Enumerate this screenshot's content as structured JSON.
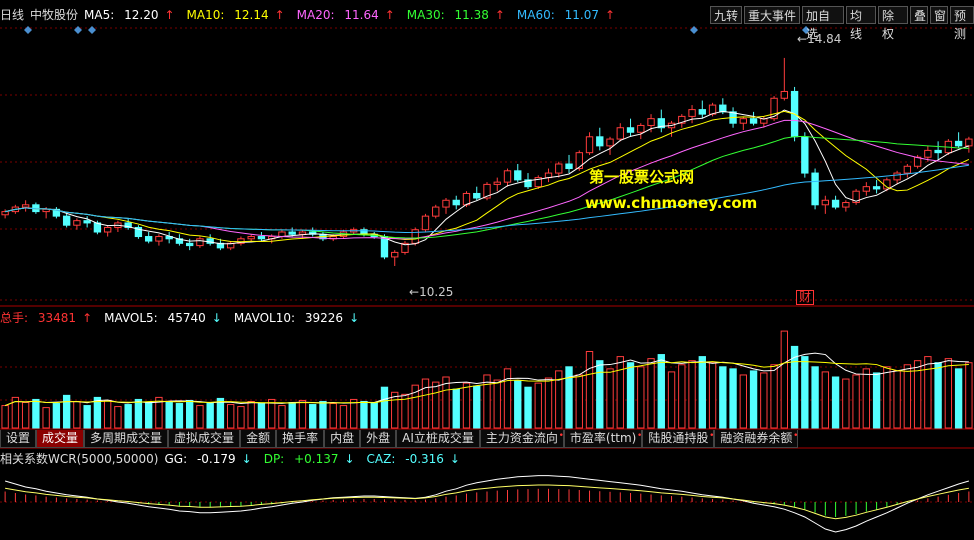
{
  "main_header": {
    "period": "日线",
    "stock_name": "中牧股份",
    "ma5_label": "MA5:",
    "ma5": "12.20",
    "ma5_arrow": "↑",
    "ma10_label": "MA10:",
    "ma10": "12.14",
    "ma10_arrow": "↑",
    "ma20_label": "MA20:",
    "ma20": "11.64",
    "ma20_arrow": "↑",
    "ma30_label": "MA30:",
    "ma30": "11.38",
    "ma30_arrow": "↑",
    "ma60_label": "MA60:",
    "ma60": "11.07",
    "ma60_arrow": "↑"
  },
  "toolbar": [
    "九转",
    "重大事件",
    "加自选",
    "均线",
    "除权",
    "叠",
    "窗",
    "预测"
  ],
  "price_high_label": "14.84",
  "price_low_label": "10.25",
  "fin_marker": "财",
  "watermark": {
    "line1": "第一股票公式网",
    "line2": "www.chnmoney.com"
  },
  "volume_header": {
    "label": "总手:",
    "value": "33481",
    "arrow": "↑",
    "mavol5_label": "MAVOL5:",
    "mavol5": "45740",
    "mavol5_arrow": "↓",
    "mavol10_label": "MAVOL10:",
    "mavol10": "39226",
    "mavol10_arrow": "↓"
  },
  "indicator_tabs": [
    {
      "label": "设置",
      "active": false,
      "dot": false
    },
    {
      "label": "成交量",
      "active": true,
      "dot": false
    },
    {
      "label": "多周期成交量",
      "active": false,
      "dot": false
    },
    {
      "label": "虚拟成交量",
      "active": false,
      "dot": false
    },
    {
      "label": "金额",
      "active": false,
      "dot": false
    },
    {
      "label": "换手率",
      "active": false,
      "dot": false
    },
    {
      "label": "内盘",
      "active": false,
      "dot": false
    },
    {
      "label": "外盘",
      "active": false,
      "dot": false
    },
    {
      "label": "AI立桩成交量",
      "active": false,
      "dot": false
    },
    {
      "label": "主力资金流向",
      "active": false,
      "dot": true
    },
    {
      "label": "市盈率(ttm)",
      "active": false,
      "dot": true
    },
    {
      "label": "陆股通持股",
      "active": false,
      "dot": true
    },
    {
      "label": "融资融券余额",
      "active": false,
      "dot": true
    }
  ],
  "indicator_header": {
    "name": "相关系数WCR(5000,50000)",
    "gg_label": "GG:",
    "gg": "-0.179",
    "gg_arrow": "↓",
    "dp_label": "DP:",
    "dp": "+0.137",
    "dp_arrow": "↓",
    "caz_label": "CAZ:",
    "caz": "-0.316",
    "caz_arrow": "↓"
  },
  "colors": {
    "up": "#ff3c3c",
    "down": "#54ffff",
    "ma5": "#ffffff",
    "ma10": "#ffff00",
    "ma20": "#ff66ff",
    "ma30": "#33ff33",
    "ma60": "#33bbff",
    "grid": "#7a0000"
  },
  "chart_data": {
    "type": "candlestick",
    "y_range": [
      9.5,
      15.5
    ],
    "candles": [
      [
        11.38,
        11.5,
        11.3,
        11.45
      ],
      [
        11.45,
        11.6,
        11.4,
        11.55
      ],
      [
        11.55,
        11.7,
        11.45,
        11.6
      ],
      [
        11.6,
        11.65,
        11.4,
        11.45
      ],
      [
        11.45,
        11.55,
        11.3,
        11.5
      ],
      [
        11.5,
        11.55,
        11.3,
        11.35
      ],
      [
        11.35,
        11.45,
        11.1,
        11.15
      ],
      [
        11.15,
        11.3,
        11.05,
        11.25
      ],
      [
        11.25,
        11.35,
        11.1,
        11.2
      ],
      [
        11.2,
        11.25,
        10.95,
        11.0
      ],
      [
        11.0,
        11.15,
        10.9,
        11.1
      ],
      [
        11.1,
        11.25,
        11.0,
        11.2
      ],
      [
        11.2,
        11.3,
        11.05,
        11.1
      ],
      [
        11.1,
        11.15,
        10.85,
        10.9
      ],
      [
        10.9,
        11.0,
        10.75,
        10.8
      ],
      [
        10.8,
        10.95,
        10.7,
        10.9
      ],
      [
        10.9,
        11.0,
        10.75,
        10.85
      ],
      [
        10.85,
        10.95,
        10.7,
        10.75
      ],
      [
        10.75,
        10.85,
        10.6,
        10.7
      ],
      [
        10.7,
        10.9,
        10.65,
        10.85
      ],
      [
        10.85,
        10.95,
        10.7,
        10.75
      ],
      [
        10.75,
        10.85,
        10.6,
        10.65
      ],
      [
        10.65,
        10.8,
        10.6,
        10.75
      ],
      [
        10.75,
        10.9,
        10.7,
        10.85
      ],
      [
        10.85,
        10.95,
        10.8,
        10.9
      ],
      [
        10.9,
        11.0,
        10.8,
        10.85
      ],
      [
        10.85,
        10.95,
        10.75,
        10.9
      ],
      [
        10.9,
        11.05,
        10.85,
        11.0
      ],
      [
        11.0,
        11.1,
        10.9,
        10.95
      ],
      [
        10.95,
        11.05,
        10.85,
        11.0
      ],
      [
        11.0,
        11.1,
        10.9,
        10.95
      ],
      [
        10.95,
        11.0,
        10.8,
        10.85
      ],
      [
        10.85,
        10.95,
        10.8,
        10.9
      ],
      [
        10.9,
        11.05,
        10.85,
        11.0
      ],
      [
        11.0,
        11.1,
        10.95,
        11.05
      ],
      [
        11.05,
        11.1,
        10.9,
        10.95
      ],
      [
        10.95,
        11.0,
        10.85,
        10.9
      ],
      [
        10.9,
        10.95,
        10.4,
        10.45
      ],
      [
        10.45,
        10.6,
        10.25,
        10.55
      ],
      [
        10.55,
        10.8,
        10.5,
        10.75
      ],
      [
        10.75,
        11.1,
        10.7,
        11.05
      ],
      [
        11.05,
        11.4,
        11.0,
        11.35
      ],
      [
        11.35,
        11.6,
        11.3,
        11.55
      ],
      [
        11.55,
        11.75,
        11.4,
        11.7
      ],
      [
        11.7,
        11.8,
        11.5,
        11.6
      ],
      [
        11.6,
        11.9,
        11.55,
        11.85
      ],
      [
        11.85,
        12.0,
        11.7,
        11.75
      ],
      [
        11.75,
        12.1,
        11.7,
        12.05
      ],
      [
        12.05,
        12.2,
        11.9,
        12.1
      ],
      [
        12.1,
        12.4,
        12.0,
        12.35
      ],
      [
        12.35,
        12.5,
        12.1,
        12.15
      ],
      [
        12.15,
        12.3,
        11.95,
        12.0
      ],
      [
        12.0,
        12.25,
        11.95,
        12.2
      ],
      [
        12.2,
        12.4,
        12.1,
        12.3
      ],
      [
        12.3,
        12.55,
        12.2,
        12.5
      ],
      [
        12.5,
        12.7,
        12.3,
        12.4
      ],
      [
        12.4,
        12.8,
        12.35,
        12.75
      ],
      [
        12.75,
        13.2,
        12.7,
        13.1
      ],
      [
        13.1,
        13.3,
        12.8,
        12.9
      ],
      [
        12.9,
        13.1,
        12.7,
        13.05
      ],
      [
        13.05,
        13.4,
        13.0,
        13.3
      ],
      [
        13.3,
        13.5,
        13.1,
        13.2
      ],
      [
        13.2,
        13.4,
        13.05,
        13.35
      ],
      [
        13.35,
        13.6,
        13.2,
        13.5
      ],
      [
        13.5,
        13.7,
        13.2,
        13.3
      ],
      [
        13.3,
        13.45,
        13.1,
        13.4
      ],
      [
        13.4,
        13.6,
        13.3,
        13.55
      ],
      [
        13.55,
        13.8,
        13.4,
        13.7
      ],
      [
        13.7,
        13.9,
        13.5,
        13.6
      ],
      [
        13.6,
        13.85,
        13.55,
        13.8
      ],
      [
        13.8,
        13.95,
        13.6,
        13.65
      ],
      [
        13.65,
        13.75,
        13.3,
        13.4
      ],
      [
        13.4,
        13.55,
        13.25,
        13.5
      ],
      [
        13.5,
        13.65,
        13.35,
        13.4
      ],
      [
        13.4,
        13.55,
        13.3,
        13.5
      ],
      [
        13.5,
        14.0,
        13.45,
        13.95
      ],
      [
        13.95,
        14.84,
        13.9,
        14.1
      ],
      [
        14.1,
        14.2,
        13.0,
        13.1
      ],
      [
        13.1,
        13.2,
        12.2,
        12.3
      ],
      [
        12.3,
        12.4,
        11.5,
        11.6
      ],
      [
        11.6,
        11.8,
        11.4,
        11.7
      ],
      [
        11.7,
        11.8,
        11.5,
        11.55
      ],
      [
        11.55,
        11.7,
        11.45,
        11.65
      ],
      [
        11.65,
        11.95,
        11.6,
        11.9
      ],
      [
        11.9,
        12.1,
        11.8,
        12.0
      ],
      [
        12.0,
        12.15,
        11.85,
        11.95
      ],
      [
        11.95,
        12.2,
        11.9,
        12.15
      ],
      [
        12.15,
        12.35,
        12.05,
        12.3
      ],
      [
        12.3,
        12.5,
        12.2,
        12.45
      ],
      [
        12.45,
        12.7,
        12.4,
        12.65
      ],
      [
        12.65,
        12.9,
        12.55,
        12.8
      ],
      [
        12.8,
        13.0,
        12.6,
        12.75
      ],
      [
        12.75,
        13.05,
        12.7,
        13.0
      ],
      [
        13.0,
        13.2,
        12.85,
        12.9
      ],
      [
        12.9,
        13.1,
        12.75,
        13.05
      ]
    ],
    "volume": [
      22,
      30,
      25,
      28,
      20,
      24,
      32,
      26,
      22,
      30,
      27,
      21,
      23,
      28,
      25,
      30,
      26,
      24,
      27,
      22,
      25,
      29,
      23,
      21,
      26,
      24,
      28,
      22,
      25,
      27,
      23,
      26,
      24,
      22,
      28,
      26,
      25,
      40,
      35,
      33,
      42,
      48,
      45,
      50,
      38,
      44,
      41,
      52,
      47,
      58,
      46,
      40,
      44,
      49,
      56,
      60,
      52,
      75,
      66,
      58,
      70,
      64,
      60,
      68,
      72,
      55,
      62,
      66,
      70,
      64,
      60,
      58,
      52,
      56,
      54,
      62,
      95,
      80,
      70,
      60,
      55,
      50,
      48,
      52,
      58,
      54,
      60,
      56,
      62,
      66,
      70,
      64,
      68,
      58,
      64
    ],
    "wcr": [
      0.35,
      0.3,
      0.25,
      0.22,
      0.18,
      0.15,
      0.12,
      0.1,
      0.08,
      0.05,
      0.03,
      0.0,
      -0.02,
      -0.05,
      -0.08,
      -0.1,
      -0.12,
      -0.15,
      -0.16,
      -0.18,
      -0.18,
      -0.17,
      -0.16,
      -0.15,
      -0.13,
      -0.1,
      -0.08,
      -0.05,
      -0.02,
      0.0,
      0.03,
      0.05,
      0.07,
      0.08,
      0.09,
      0.1,
      0.1,
      0.09,
      0.08,
      0.07,
      0.06,
      0.08,
      0.12,
      0.18,
      0.22,
      0.28,
      0.32,
      0.35,
      0.38,
      0.4,
      0.42,
      0.43,
      0.44,
      0.44,
      0.43,
      0.42,
      0.4,
      0.38,
      0.36,
      0.34,
      0.32,
      0.3,
      0.28,
      0.25,
      0.22,
      0.2,
      0.18,
      0.15,
      0.12,
      0.1,
      0.08,
      0.05,
      0.02,
      -0.02,
      -0.05,
      -0.08,
      -0.12,
      -0.18,
      -0.25,
      -0.35,
      -0.45,
      -0.5,
      -0.46,
      -0.4,
      -0.32,
      -0.25,
      -0.18,
      -0.1,
      -0.02,
      0.05,
      0.12,
      0.18,
      0.24,
      0.3,
      0.35
    ]
  }
}
